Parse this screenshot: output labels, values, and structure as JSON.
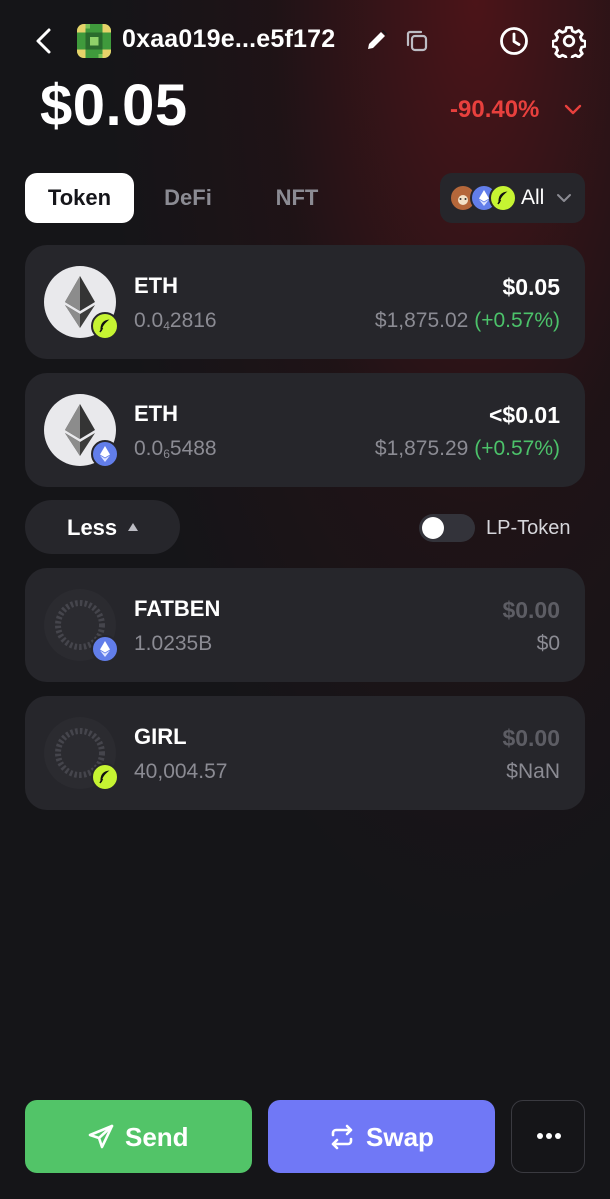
{
  "header": {
    "wallet_address": "0xaa019e...e5f172",
    "balance": "$0.05",
    "change": "-90.40%"
  },
  "tabs": {
    "token": "Token",
    "defi": "DeFi",
    "nft": "NFT",
    "active": "Token"
  },
  "chain_filter": {
    "label": "All"
  },
  "tokens": [
    {
      "name": "ETH",
      "amount_prefix": "0.0",
      "amount_sub": "4",
      "amount_suffix": "2816",
      "value": "$0.05",
      "price": "$1,875.02",
      "price_change": "(+0.57%)",
      "chain_badge": "leaf-chain-icon"
    },
    {
      "name": "ETH",
      "amount_prefix": "0.0",
      "amount_sub": "6",
      "amount_suffix": "5488",
      "value": "<$0.01",
      "price": "$1,875.29",
      "price_change": "(+0.57%)",
      "chain_badge": "ethereum-icon"
    }
  ],
  "less_button": "Less",
  "lp_toggle": {
    "label": "LP-Token",
    "on": false
  },
  "hidden_tokens": [
    {
      "name": "FATBEN",
      "amount": "1.0235B",
      "value": "$0.00",
      "price": "$0",
      "chain_badge": "ethereum-icon"
    },
    {
      "name": "GIRL",
      "amount": "40,004.57",
      "value": "$0.00",
      "price": "$NaN",
      "chain_badge": "leaf-chain-icon"
    }
  ],
  "actions": {
    "send": "Send",
    "swap": "Swap"
  },
  "colors": {
    "negative": "#e8403d",
    "positive": "#4cc26a",
    "send": "#52c468",
    "swap": "#7078f6",
    "leaf_badge": "#c6f432",
    "eth_badge": "#627eea"
  }
}
